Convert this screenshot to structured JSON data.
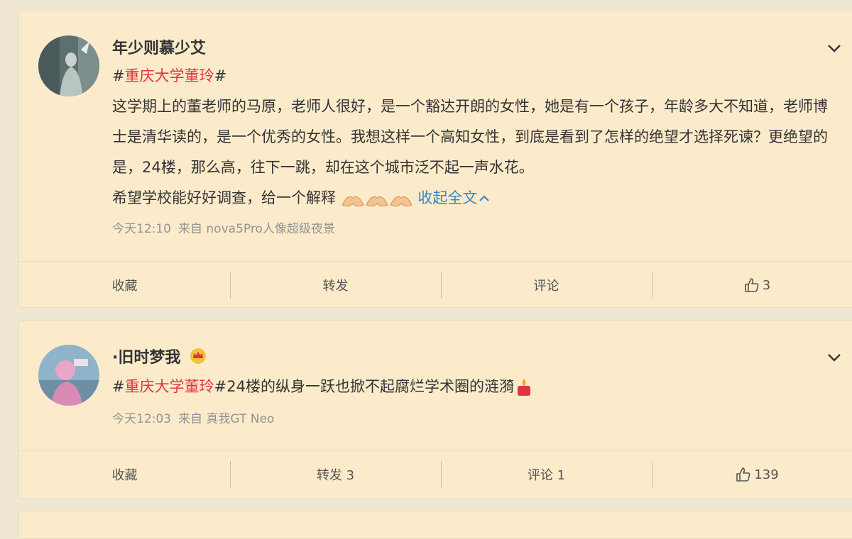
{
  "posts": [
    {
      "username": "年少则慕少艾",
      "hashtag": "重庆大学董玲",
      "hash_symbol": "#",
      "body_line1": "这学期上的董老师的马原，老师人很好，是一个豁达开朗的女性，她是有一个孩子，年龄多大不知道，老师博士是清华读的，是一个优秀的女性。我想这样一个高知女性，到底是看到了怎样的绝望才选择死谏？更绝望的是，24楼，那么高，往下一跳，却在这个城市泛不起一声水花。",
      "body_line2": "希望学校能好好调查，给一个解释",
      "emojis": [
        "praying-hands-emoji",
        "praying-hands-emoji",
        "praying-hands-emoji"
      ],
      "collapse_label": "收起全文",
      "time": "今天12:10",
      "source": "来自 nova5Pro人像超级夜景",
      "actions": {
        "favorite": "收藏",
        "repost": "转发",
        "comment": "评论",
        "like": "3"
      }
    },
    {
      "username": "·旧时梦我",
      "badge": "crown-badge-icon",
      "hashtag": "重庆大学董玲",
      "hash_symbol": "#",
      "body": "24楼的纵身一跃也掀不起腐烂学术圈的涟漪",
      "emoji": "candle-emoji",
      "time": "今天12:03",
      "source": "来自 真我GT Neo",
      "actions": {
        "favorite": "收藏",
        "repost": "转发 3",
        "comment": "评论 1",
        "like": "139"
      }
    }
  ],
  "colors": {
    "background": "#efe7d1",
    "card": "#fcebcb",
    "hashtag": "#e2333e",
    "link": "#2f86c9",
    "meta": "#939393"
  }
}
